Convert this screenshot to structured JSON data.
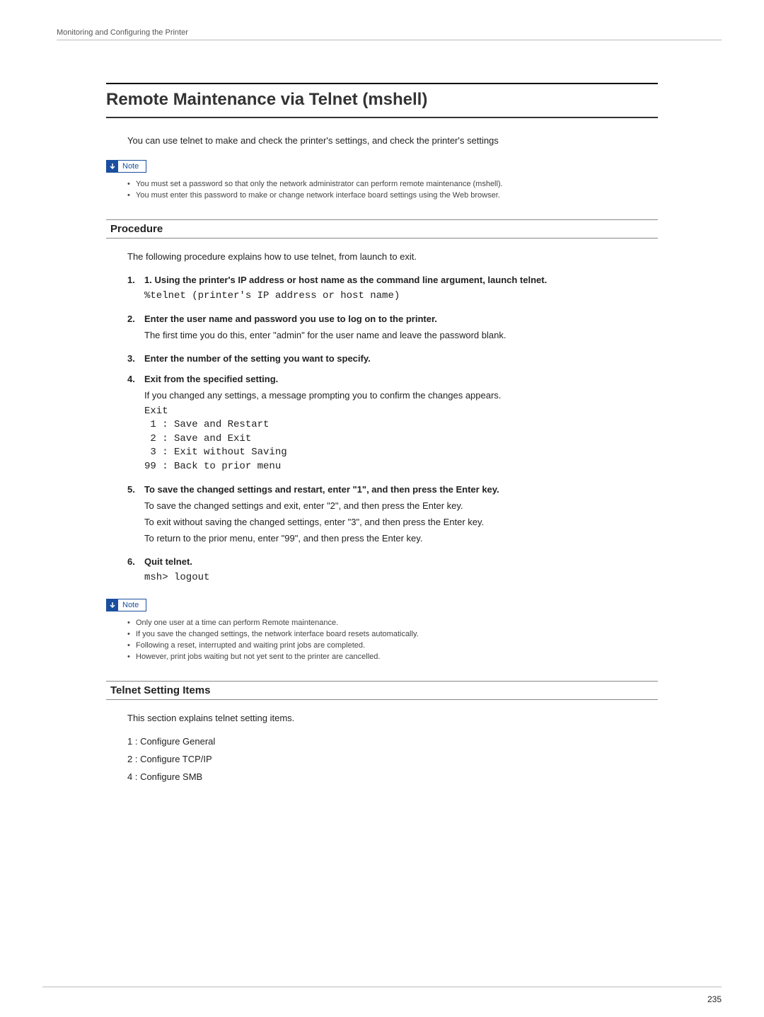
{
  "running_head": "Monitoring and Configuring the Printer",
  "main_title": "Remote Maintenance via Telnet (mshell)",
  "intro": "You can use telnet to make and check the printer's settings, and check the printer's settings",
  "note_label": "Note",
  "note1": {
    "items": [
      "You must set a password so that only the network administrator can perform remote maintenance (mshell).",
      "You must enter this password to make or change network interface board settings using the Web browser."
    ]
  },
  "procedure": {
    "title": "Procedure",
    "intro": "The following procedure explains how to use telnet, from launch to exit.",
    "steps": [
      {
        "num": "1.",
        "bold": "1. Using the printer's IP address or host name as the command line argument, launch telnet.",
        "mono": "%telnet (printer's IP address or host name)"
      },
      {
        "num": "2.",
        "bold": "Enter the user name and password you use to log on to the printer.",
        "sub": "The first time you do this, enter \"admin\" for the user name and leave the password blank."
      },
      {
        "num": "3.",
        "bold": "Enter the number of the setting you want to specify."
      },
      {
        "num": "4.",
        "bold": "Exit from the specified setting.",
        "sub": "If you changed any settings, a message prompting you to confirm the changes appears.",
        "mono": "Exit\n 1 : Save and Restart\n 2 : Save and Exit\n 3 : Exit without Saving\n99 : Back to prior menu"
      },
      {
        "num": "5.",
        "bold": "To save the changed settings and restart, enter \"1\", and then press the Enter key.",
        "subs": [
          "To save the changed settings and exit, enter \"2\", and then press the Enter key.",
          "To exit without saving the changed settings, enter \"3\", and then press the Enter key.",
          "To return to the prior menu, enter \"99\", and then press the Enter key."
        ]
      },
      {
        "num": "6.",
        "bold": "Quit telnet.",
        "mono": "msh> logout"
      }
    ]
  },
  "note2": {
    "items": [
      "Only one user at a time can perform Remote maintenance.",
      "If you save the changed settings, the network interface board resets automatically.",
      "Following a reset, interrupted and waiting print jobs are completed.",
      "However, print jobs waiting but not yet sent to the printer are cancelled."
    ]
  },
  "telnet_settings": {
    "title": "Telnet Setting Items",
    "intro": "This section explains telnet setting items.",
    "items": [
      "1 : Configure General",
      "2 : Configure TCP/IP",
      "4 : Configure SMB"
    ]
  },
  "page_number": "235"
}
